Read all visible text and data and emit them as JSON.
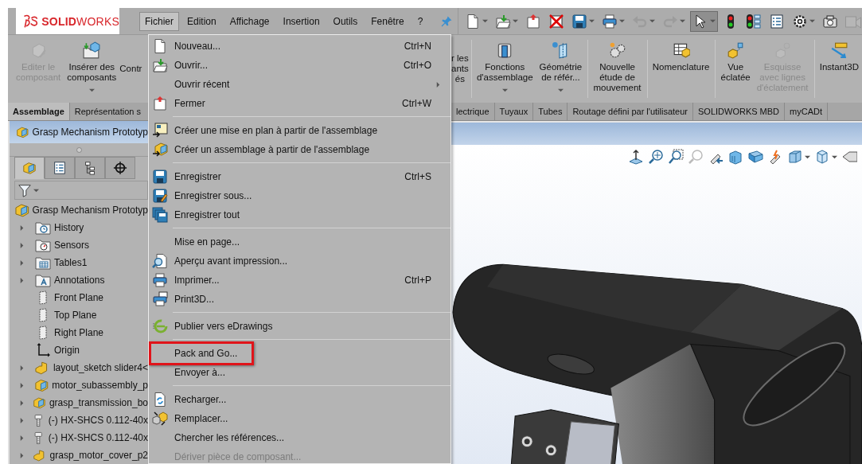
{
  "logo": "**SOLID**WORKS",
  "menu_bar": [
    {
      "label": "Fichier",
      "selected": true
    },
    {
      "label": "Edition",
      "selected": false
    },
    {
      "label": "Affichage",
      "selected": false
    },
    {
      "label": "Insertion",
      "selected": false
    },
    {
      "label": "Outils",
      "selected": false
    },
    {
      "label": "Fenêtre",
      "selected": false
    },
    {
      "label": "?",
      "selected": false
    }
  ],
  "quick_toolbar": [
    {
      "dropdown": true,
      "disabled": false,
      "selected": false
    },
    {
      "dropdown": true,
      "disabled": false,
      "selected": false
    },
    {
      "dropdown": false,
      "disabled": false,
      "selected": false
    },
    {
      "dropdown": false,
      "disabled": false,
      "selected": false
    },
    {
      "dropdown": true,
      "disabled": false,
      "selected": false
    },
    {
      "dropdown": true,
      "disabled": false,
      "selected": false
    },
    {
      "dropdown": true,
      "disabled": true,
      "selected": false
    },
    {
      "dropdown": true,
      "disabled": true,
      "selected": false
    },
    {
      "dropdown": true,
      "disabled": false,
      "selected": true
    },
    {
      "dropdown": false,
      "disabled": false,
      "selected": false
    },
    {
      "dropdown": false,
      "disabled": false,
      "selected": false
    },
    {
      "dropdown": false,
      "disabled": false,
      "selected": false
    },
    {
      "dropdown": true,
      "disabled": false,
      "selected": false
    },
    {
      "dropdown": false,
      "disabled": false,
      "selected": false
    },
    {
      "dropdown": false,
      "disabled": true,
      "selected": false
    }
  ],
  "ribbon": [
    {
      "label": "Editer le\ncomposant",
      "disabled": true,
      "dropdown": false
    },
    {
      "label": "Insérer des\ncomposants",
      "disabled": false,
      "dropdown": true
    },
    {
      "label": "Contr",
      "disabled": false,
      "dropdown": false
    },
    {
      "label": "r les\nants\nés",
      "disabled": false,
      "dropdown": false
    },
    {
      "label": "Fonctions\nd'assemblage",
      "disabled": false,
      "dropdown": true
    },
    {
      "label": "Géométrie\nde référ...",
      "disabled": false,
      "dropdown": true
    },
    {
      "label": "Nouvelle\nétude de\nmouvement",
      "disabled": false,
      "dropdown": false
    },
    {
      "label": "Nomenclature",
      "disabled": false,
      "dropdown": false
    },
    {
      "label": "Vue\néclatée",
      "disabled": false,
      "dropdown": false
    },
    {
      "label": "Esquisse\navec lignes\nd'éclatement",
      "disabled": true,
      "dropdown": false
    },
    {
      "label": "Instant3D",
      "disabled": false,
      "dropdown": false
    }
  ],
  "command_tabs": [
    {
      "label": "Assemblage",
      "selected": true
    },
    {
      "label": "Représentation s",
      "selected": false
    },
    {
      "label": "lectrique",
      "selected": false
    },
    {
      "label": "Tuyaux",
      "selected": false
    },
    {
      "label": "Tubes",
      "selected": false
    },
    {
      "label": "Routage défini par l'utilisateur",
      "selected": false
    },
    {
      "label": "SOLIDWORKS MBD",
      "selected": false
    },
    {
      "label": "myCADt",
      "selected": false
    }
  ],
  "feature_manager": {
    "title": "Grasp Mechanism Prototyp",
    "tabs": [
      {
        "selected": true
      },
      {
        "selected": false
      },
      {
        "selected": false
      },
      {
        "selected": false
      }
    ],
    "tree": {
      "label": "Grasp Mechanism Prototyp",
      "kind": "assembly",
      "children": [
        {
          "label": "History",
          "kind": "history",
          "collapsible": true
        },
        {
          "label": "Sensors",
          "kind": "sensors",
          "collapsible": true
        },
        {
          "label": "Tables1",
          "kind": "tables",
          "collapsible": true
        },
        {
          "label": "Annotations",
          "kind": "annotations",
          "collapsible": true
        },
        {
          "label": "Front Plane",
          "kind": "plane",
          "collapsible": false
        },
        {
          "label": "Top Plane",
          "kind": "plane",
          "collapsible": false
        },
        {
          "label": "Right Plane",
          "kind": "plane",
          "collapsible": false
        },
        {
          "label": "Origin",
          "kind": "origin",
          "collapsible": false
        },
        {
          "label": "layout_sketch slider4<",
          "kind": "part",
          "collapsible": true
        },
        {
          "label": "motor_subassembly_p",
          "kind": "assembly",
          "collapsible": true
        },
        {
          "label": "grasp_transmission_bo",
          "kind": "assembly",
          "collapsible": true
        },
        {
          "label": "(-) HX-SHCS 0.112-40x",
          "kind": "screw",
          "collapsible": true
        },
        {
          "label": "(-) HX-SHCS 0.112-40x",
          "kind": "screw",
          "collapsible": true
        },
        {
          "label": "grasp_motor_cover_p2",
          "kind": "part",
          "collapsible": true
        }
      ]
    }
  },
  "file_menu": {
    "items": [
      {
        "kind": "item",
        "label": "Nouveau...",
        "shortcut": "Ctrl+N",
        "submenu": false,
        "disabled": false,
        "highlighted": false
      },
      {
        "kind": "item",
        "label": "Ouvrir...",
        "shortcut": "Ctrl+O",
        "submenu": false,
        "disabled": false,
        "highlighted": false
      },
      {
        "kind": "item",
        "label": "Ouvrir récent",
        "submenu": true,
        "disabled": false,
        "highlighted": false
      },
      {
        "kind": "item",
        "label": "Fermer",
        "shortcut": "Ctrl+W",
        "submenu": false,
        "disabled": false,
        "highlighted": false
      },
      {
        "kind": "separator"
      },
      {
        "kind": "item",
        "label": "Créer une mise en plan à partir de l'assemblage",
        "submenu": false,
        "disabled": false,
        "highlighted": false
      },
      {
        "kind": "item",
        "label": "Créer un assemblage à partir de l'assemblage",
        "submenu": false,
        "disabled": false,
        "highlighted": false
      },
      {
        "kind": "separator"
      },
      {
        "kind": "item",
        "label": "Enregistrer",
        "shortcut": "Ctrl+S",
        "submenu": false,
        "disabled": false,
        "highlighted": false
      },
      {
        "kind": "item",
        "label": "Enregistrer sous...",
        "submenu": false,
        "disabled": false,
        "highlighted": false
      },
      {
        "kind": "item",
        "label": "Enregistrer tout",
        "submenu": false,
        "disabled": false,
        "highlighted": false
      },
      {
        "kind": "separator"
      },
      {
        "kind": "item",
        "label": "Mise en page...",
        "submenu": false,
        "disabled": false,
        "highlighted": false
      },
      {
        "kind": "item",
        "label": "Aperçu avant impression...",
        "submenu": false,
        "disabled": false,
        "highlighted": false
      },
      {
        "kind": "item",
        "label": "Imprimer...",
        "shortcut": "Ctrl+P",
        "submenu": false,
        "disabled": false,
        "highlighted": false
      },
      {
        "kind": "item",
        "label": "Print3D...",
        "submenu": false,
        "disabled": false,
        "highlighted": false
      },
      {
        "kind": "separator"
      },
      {
        "kind": "item",
        "label": "Publier vers eDrawings",
        "submenu": false,
        "disabled": false,
        "highlighted": false
      },
      {
        "kind": "separator"
      },
      {
        "kind": "item",
        "label": "Pack and Go...",
        "submenu": false,
        "disabled": false,
        "highlighted": true
      },
      {
        "kind": "item",
        "label": "Envoyer à...",
        "submenu": false,
        "disabled": false,
        "highlighted": false
      },
      {
        "kind": "separator"
      },
      {
        "kind": "item",
        "label": "Recharger...",
        "submenu": false,
        "disabled": false,
        "highlighted": false
      },
      {
        "kind": "item",
        "label": "Remplacer...",
        "submenu": false,
        "disabled": false,
        "highlighted": false
      },
      {
        "kind": "item",
        "label": "Chercher les références...",
        "submenu": false,
        "disabled": false,
        "highlighted": false
      },
      {
        "kind": "item",
        "label": "Dériver pièce de composant...",
        "submenu": false,
        "disabled": true,
        "highlighted": false
      }
    ]
  }
}
